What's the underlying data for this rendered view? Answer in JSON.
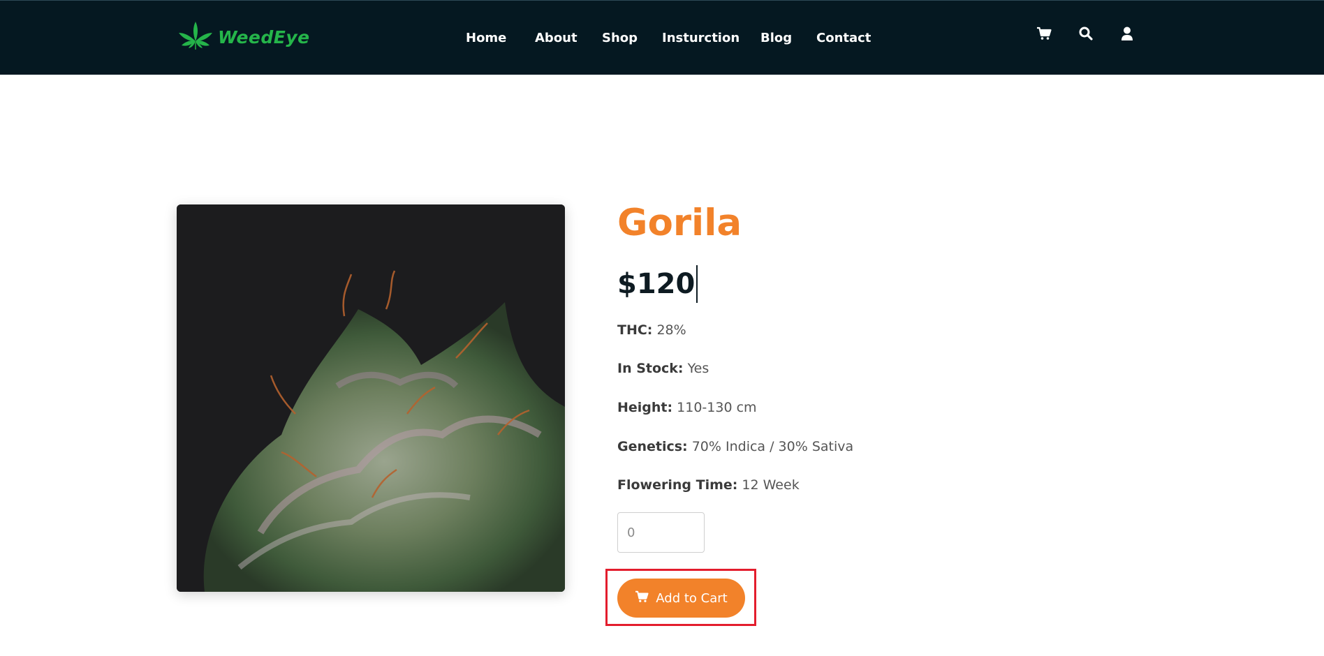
{
  "brand": {
    "name": "WeedEye",
    "logo_icon": "cannabis-leaf-icon",
    "color": "#25b54a"
  },
  "nav": {
    "items": [
      {
        "label": "Home"
      },
      {
        "label": "About"
      },
      {
        "label": "Shop"
      },
      {
        "label": "Insturction"
      },
      {
        "label": "Blog"
      },
      {
        "label": "Contact"
      }
    ],
    "icons": [
      "cart-icon",
      "search-icon",
      "user-icon"
    ]
  },
  "product": {
    "image": "cannabis-bud-photo",
    "title": "Gorila",
    "price": "$120",
    "attributes": [
      {
        "key": "THC:",
        "value": "28%"
      },
      {
        "key": "In Stock:",
        "value": "Yes"
      },
      {
        "key": "Height:",
        "value": "110-130 cm"
      },
      {
        "key": "Genetics:",
        "value": "70% Indica / 30% Sativa"
      },
      {
        "key": "Flowering Time:",
        "value": "12 Week"
      }
    ],
    "quantity_placeholder": "0",
    "add_to_cart_label": "Add to Cart"
  },
  "colors": {
    "navbar_bg": "#051821",
    "accent": "#f2822a",
    "highlight": "#e31d2d"
  }
}
